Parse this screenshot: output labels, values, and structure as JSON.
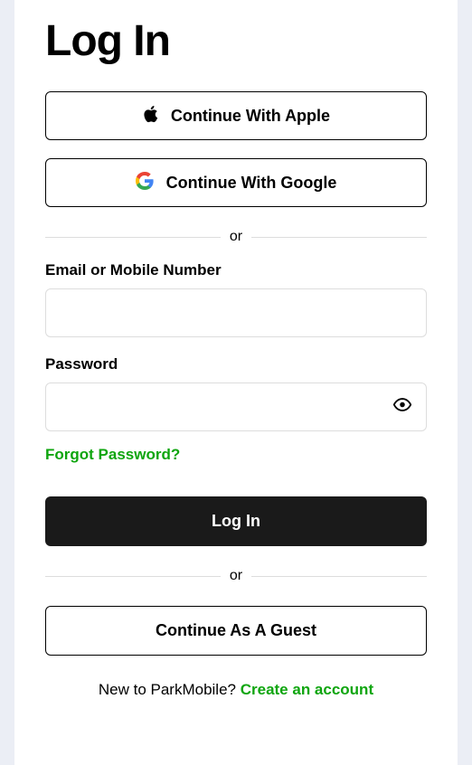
{
  "title": "Log In",
  "oauth": {
    "apple": "Continue With Apple",
    "google": "Continue With Google"
  },
  "divider": "or",
  "form": {
    "email_label": "Email or Mobile Number",
    "password_label": "Password",
    "forgot": "Forgot Password?"
  },
  "buttons": {
    "login": "Log In",
    "guest": "Continue As A Guest"
  },
  "footer": {
    "prompt": "New to ParkMobile? ",
    "link": "Create an account"
  }
}
